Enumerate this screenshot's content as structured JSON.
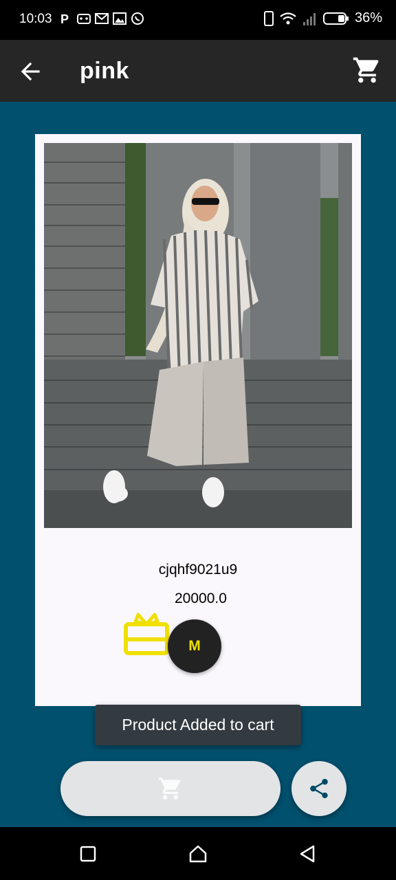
{
  "status_bar": {
    "time": "10:03",
    "battery_percent": "36%",
    "icons_left": [
      "parking-icon",
      "gamepad-icon",
      "gmail-icon",
      "gallery-icon",
      "whatsapp-icon"
    ],
    "icons_right": [
      "vibrate-icon",
      "wifi-icon",
      "signal-icon",
      "battery-icon"
    ]
  },
  "app_bar": {
    "title": "pink",
    "back_icon": "arrow-left-icon",
    "cart_icon": "cart-icon"
  },
  "product": {
    "code": "cjqhf9021u9",
    "price": "20000.0",
    "size": "M",
    "gift_icon": "gift-card-icon"
  },
  "toast": {
    "message": "Product Added to cart"
  },
  "actions": {
    "add_to_cart_icon": "cart-icon",
    "share_icon": "share-icon"
  },
  "nav_bar": {
    "icons": [
      "recents-square-icon",
      "home-icon",
      "back-triangle-icon"
    ]
  },
  "colors": {
    "background": "#00506e",
    "app_bar": "#262626",
    "card": "#faf8fd",
    "accent_yellow": "#f0e000",
    "button_grey": "#e2e4e6",
    "toast": "#333a40"
  }
}
